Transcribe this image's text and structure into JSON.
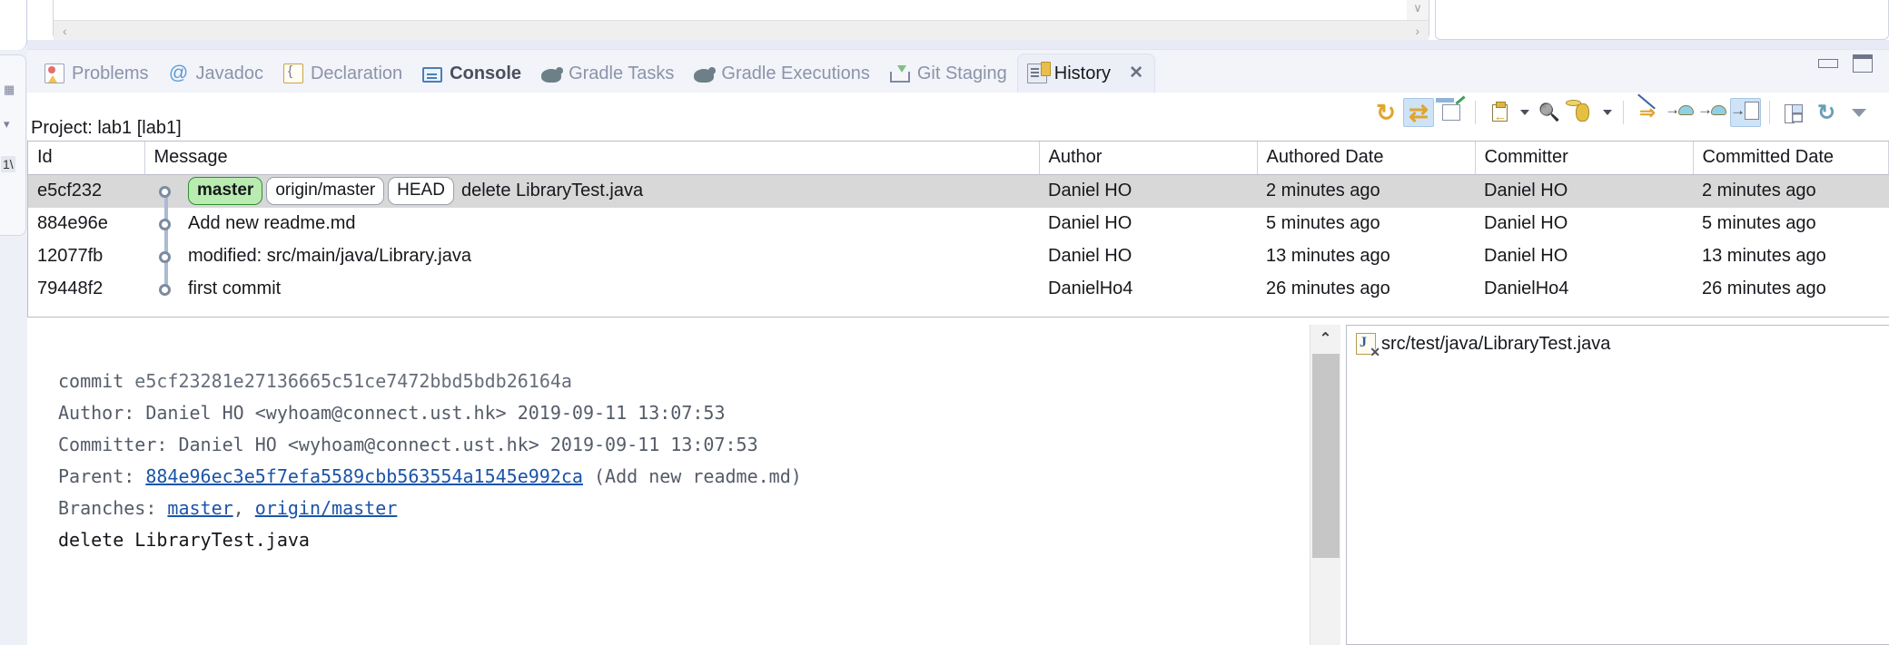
{
  "left_rail": {
    "label_1": "1\\"
  },
  "top_panel": {
    "scroll_down_glyph": "∨",
    "scroll_left_glyph": "‹",
    "scroll_right_glyph": "›"
  },
  "window_controls": {
    "minimize": "minimize-view",
    "maximize": "maximize-view"
  },
  "tabs": [
    {
      "label": "Problems",
      "icon": "problems-icon",
      "active": false,
      "bold": false
    },
    {
      "label": "Javadoc",
      "icon": "javadoc-icon",
      "active": false,
      "bold": false
    },
    {
      "label": "Declaration",
      "icon": "declaration-icon",
      "active": false,
      "bold": false
    },
    {
      "label": "Console",
      "icon": "console-icon",
      "active": false,
      "bold": true
    },
    {
      "label": "Gradle Tasks",
      "icon": "gradle-tasks-icon",
      "active": false,
      "bold": false
    },
    {
      "label": "Gradle Executions",
      "icon": "gradle-executions-icon",
      "active": false,
      "bold": false
    },
    {
      "label": "Git Staging",
      "icon": "git-staging-icon",
      "active": false,
      "bold": false
    },
    {
      "label": "History",
      "icon": "history-icon",
      "active": true,
      "bold": false
    }
  ],
  "active_tab_close": "✕",
  "toolbar": {
    "buttons": [
      {
        "name": "refresh-icon",
        "toggled": false
      },
      {
        "name": "compare-mode-icon",
        "toggled": true
      },
      {
        "name": "show-in-editor-icon",
        "toggled": false
      },
      {
        "name": "select-repository-icon",
        "toggled": false
      },
      {
        "name": "select-repository-dropdown-icon",
        "toggled": false
      },
      {
        "name": "search-icon",
        "toggled": false
      },
      {
        "name": "filter-icon",
        "toggled": false
      },
      {
        "name": "filter-dropdown-icon",
        "toggled": false
      },
      {
        "name": "show-all-branches-icon",
        "toggled": false
      },
      {
        "name": "show-first-parent-icon",
        "toggled": false
      },
      {
        "name": "show-additional-refs-icon",
        "toggled": false
      },
      {
        "name": "show-comment-icon",
        "toggled": true
      },
      {
        "name": "layout-columns-icon",
        "toggled": false
      },
      {
        "name": "reverse-sort-icon",
        "toggled": false
      },
      {
        "name": "view-menu-icon",
        "toggled": false
      }
    ]
  },
  "project_label": "Project: lab1 [lab1]",
  "table": {
    "columns": [
      "Id",
      "Message",
      "Author",
      "Authored Date",
      "Committer",
      "Committed Date"
    ],
    "rows": [
      {
        "id": "e5cf232",
        "badges": [
          {
            "text": "master",
            "style": "green"
          },
          {
            "text": "origin/master",
            "style": "plain"
          },
          {
            "text": "HEAD",
            "style": "plain"
          }
        ],
        "message": "delete LibraryTest.java",
        "author": "Daniel HO",
        "authored_date": "2 minutes ago",
        "committer": "Daniel HO",
        "committed_date": "2 minutes ago",
        "selected": true
      },
      {
        "id": "884e96e",
        "badges": [],
        "message": "Add new readme.md",
        "author": "Daniel HO",
        "authored_date": "5 minutes ago",
        "committer": "Daniel HO",
        "committed_date": "5 minutes ago",
        "selected": false
      },
      {
        "id": "12077fb",
        "badges": [],
        "message": "modified:   src/main/java/Library.java",
        "author": "Daniel HO",
        "authored_date": "13 minutes ago",
        "committer": "Daniel HO",
        "committed_date": "13 minutes ago",
        "selected": false
      },
      {
        "id": "79448f2",
        "badges": [],
        "message": "first commit",
        "author": "DanielHo4",
        "authored_date": "26 minutes ago",
        "committer": "DanielHo4",
        "committed_date": "26 minutes ago",
        "selected": false
      }
    ]
  },
  "detail": {
    "commit_label": "commit ",
    "commit_hash": "e5cf23281e27136665c51ce7472bbd5bdb26164a",
    "author_label": "Author: ",
    "author_value": "Daniel HO <wyhoam@connect.ust.hk> 2019-09-11 13:07:53",
    "committer_label": "Committer: ",
    "committer_value": "Daniel HO <wyhoam@connect.ust.hk> 2019-09-11 13:07:53",
    "parent_label": "Parent: ",
    "parent_hash": "884e96ec3e5f7efa5589cbb563554a1545e992ca",
    "parent_suffix": " (Add new readme.md)",
    "branches_label": "Branches: ",
    "branch_1": "master",
    "branches_sep": ", ",
    "branch_2": "origin/master",
    "message_body": "delete LibraryTest.java",
    "scroll_up_glyph": "⌃"
  },
  "file_list": {
    "files": [
      {
        "path": "src/test/java/LibraryTest.java",
        "icon": "java-file-deleted-icon"
      }
    ]
  },
  "colors": {
    "selection": "#d8d8d8",
    "branch_green": "#b9ecb0",
    "link": "#1b54a8",
    "tab_bar": "#f2f4fa",
    "graph_line": "#a9bcd4"
  }
}
